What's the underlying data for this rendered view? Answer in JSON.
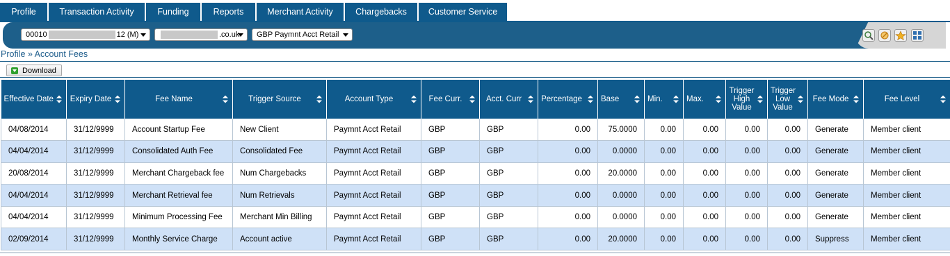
{
  "nav": {
    "tabs": [
      "Profile",
      "Transaction Activity",
      "Funding",
      "Reports",
      "Merchant Activity",
      "Chargebacks",
      "Customer Service"
    ]
  },
  "filters": {
    "merchant_prefix": "00010",
    "merchant_suffix": "12 (M)",
    "domain_suffix": ".co.uk",
    "account": "GBP Paymnt Acct Retail"
  },
  "toolbar_icons": [
    "search-icon",
    "cancel-icon",
    "star-icon",
    "expand-icon"
  ],
  "breadcrumb": "Profile » Account Fees",
  "download_label": "Download",
  "table": {
    "columns": [
      "Effective Date",
      "Expiry Date",
      "Fee Name",
      "Trigger Source",
      "Account Type",
      "Fee Curr.",
      "Acct. Curr",
      "Percentage",
      "Base",
      "Min.",
      "Max.",
      "Trigger High Value",
      "Trigger Low Value",
      "Fee Mode",
      "Fee Level"
    ],
    "rows": [
      [
        "04/08/2014",
        "31/12/9999",
        "Account Startup Fee",
        "New Client",
        "Paymnt Acct Retail",
        "GBP",
        "GBP",
        "0.00",
        "75.0000",
        "0.00",
        "0.00",
        "0.00",
        "0.00",
        "Generate",
        "Member client"
      ],
      [
        "04/04/2014",
        "31/12/9999",
        "Consolidated Auth Fee",
        "Consolidated Fee",
        "Paymnt Acct Retail",
        "GBP",
        "GBP",
        "0.00",
        "0.0000",
        "0.00",
        "0.00",
        "0.00",
        "0.00",
        "Generate",
        "Member client"
      ],
      [
        "20/08/2014",
        "31/12/9999",
        "Merchant Chargeback fee",
        "Num Chargebacks",
        "Paymnt Acct Retail",
        "GBP",
        "GBP",
        "0.00",
        "20.0000",
        "0.00",
        "0.00",
        "0.00",
        "0.00",
        "Generate",
        "Member client"
      ],
      [
        "04/04/2014",
        "31/12/9999",
        "Merchant Retrieval fee",
        "Num Retrievals",
        "Paymnt Acct Retail",
        "GBP",
        "GBP",
        "0.00",
        "0.0000",
        "0.00",
        "0.00",
        "0.00",
        "0.00",
        "Generate",
        "Member client"
      ],
      [
        "04/04/2014",
        "31/12/9999",
        "Minimum Processing Fee",
        "Merchant Min Billing",
        "Paymnt Acct Retail",
        "GBP",
        "GBP",
        "0.00",
        "0.0000",
        "0.00",
        "0.00",
        "0.00",
        "0.00",
        "Generate",
        "Member client"
      ],
      [
        "02/09/2014",
        "31/12/9999",
        "Monthly Service Charge",
        "Account active",
        "Paymnt Acct Retail",
        "GBP",
        "GBP",
        "0.00",
        "20.0000",
        "0.00",
        "0.00",
        "0.00",
        "0.00",
        "Suppress",
        "Member client"
      ]
    ]
  },
  "colors": {
    "nav_bg": "#0f5a8c",
    "alt_row": "#cfe1f7",
    "link": "#1f5e8c"
  }
}
